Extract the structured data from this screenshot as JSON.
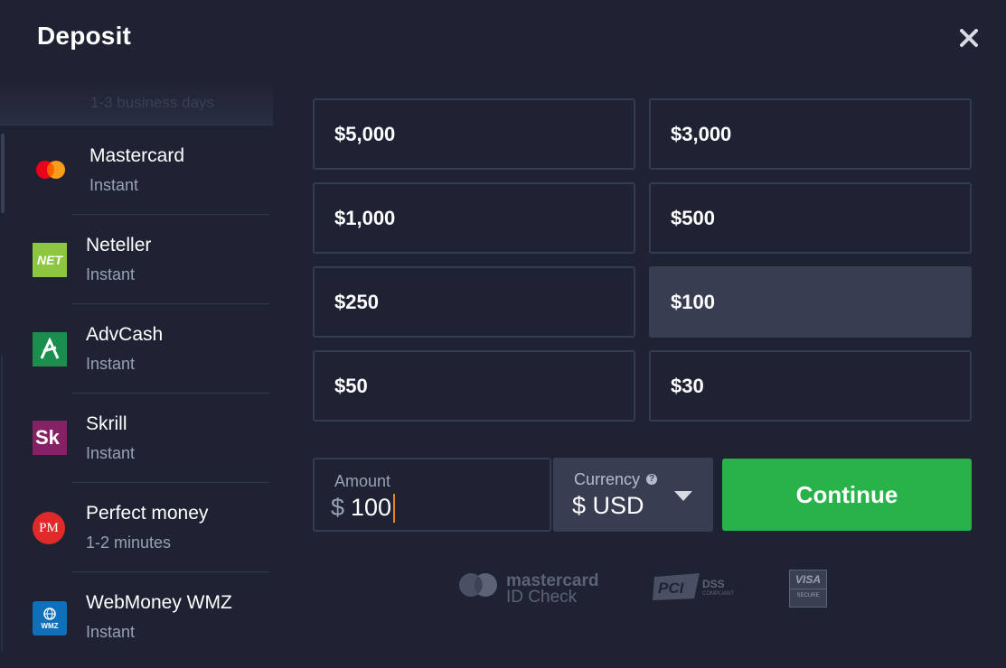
{
  "header": {
    "title": "Deposit",
    "close_icon": "close-icon"
  },
  "methods": {
    "bank_row_subtitle": "1-3 business days",
    "items": [
      {
        "name": "Mastercard",
        "speed": "Instant",
        "icon": "mastercard-logo"
      },
      {
        "name": "Neteller",
        "speed": "Instant",
        "icon": "neteller-logo",
        "logo_text": "NET"
      },
      {
        "name": "AdvCash",
        "speed": "Instant",
        "icon": "advcash-logo"
      },
      {
        "name": "Skrill",
        "speed": "Instant",
        "icon": "skrill-logo",
        "logo_text": "Sk"
      },
      {
        "name": "Perfect money",
        "speed": "1-2 minutes",
        "icon": "perfect-money-logo",
        "logo_text": "PM"
      },
      {
        "name": "WebMoney WMZ",
        "speed": "Instant",
        "icon": "webmoney-logo",
        "logo_text": "WMZ"
      }
    ]
  },
  "presets": [
    {
      "label": "$5,000",
      "selected": false
    },
    {
      "label": "$3,000",
      "selected": false
    },
    {
      "label": "$1,000",
      "selected": false
    },
    {
      "label": "$500",
      "selected": false
    },
    {
      "label": "$250",
      "selected": false
    },
    {
      "label": "$100",
      "selected": true
    },
    {
      "label": "$50",
      "selected": false
    },
    {
      "label": "$30",
      "selected": false
    }
  ],
  "amount": {
    "label": "Amount",
    "currency_symbol": "$",
    "value": "100"
  },
  "currency": {
    "label": "Currency",
    "help": "?",
    "value": "$ USD"
  },
  "continue_label": "Continue",
  "badges": {
    "mastercard_line1": "mastercard",
    "mastercard_line2": "ID Check",
    "pci_text": "DSS",
    "pci_sub": "COMPLIANT",
    "visa_line1": "VISA",
    "visa_line2": "SECURE"
  },
  "colors": {
    "background": "#1f2232",
    "border": "#343a4f",
    "selected": "#383d52",
    "continue": "#2ab24a",
    "muted_text": "#9aa0b3",
    "caret": "#e8821c"
  }
}
